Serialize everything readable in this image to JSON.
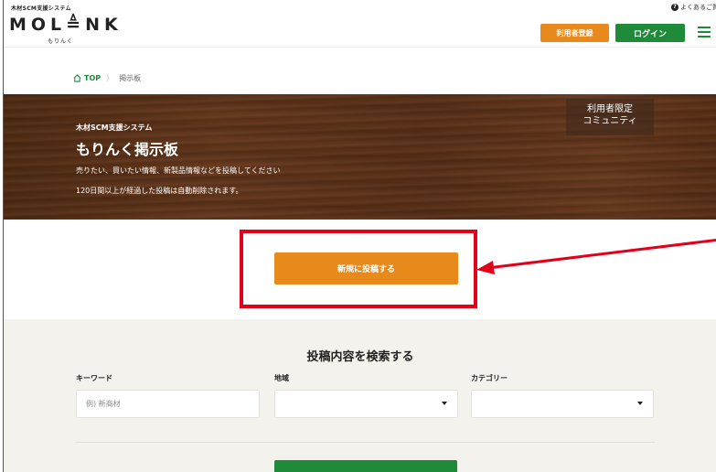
{
  "header": {
    "logo_sub": "木材SCM支援システム",
    "logo_main": "MOL≜NK",
    "logo_kana": "もりんく",
    "faq_link": "よくあるご質",
    "register_button": "利用者登録",
    "login_button": "ログイン"
  },
  "breadcrumb": {
    "home": "TOP",
    "separator": "〉",
    "current": "掲示板"
  },
  "hero": {
    "badge_line1": "利用者限定",
    "badge_line2": "コミュニティ",
    "subtitle": "木材SCM支援システム",
    "title": "もりんく掲示板",
    "description1": "売りたい、買いたい情報、新製品情報などを投稿してください",
    "description2": "120日間以上が経過した投稿は自動削除されます。"
  },
  "new_post_button": "新規に投稿する",
  "search": {
    "title": "投稿内容を検索する",
    "keyword_label": "キーワード",
    "keyword_placeholder": "例) 新商材",
    "region_label": "地域",
    "region_value": "",
    "category_label": "カテゴリー",
    "category_value": ""
  },
  "colors": {
    "orange": "#e8891c",
    "green": "#1f8a3a",
    "highlight_red": "#e3001b"
  }
}
